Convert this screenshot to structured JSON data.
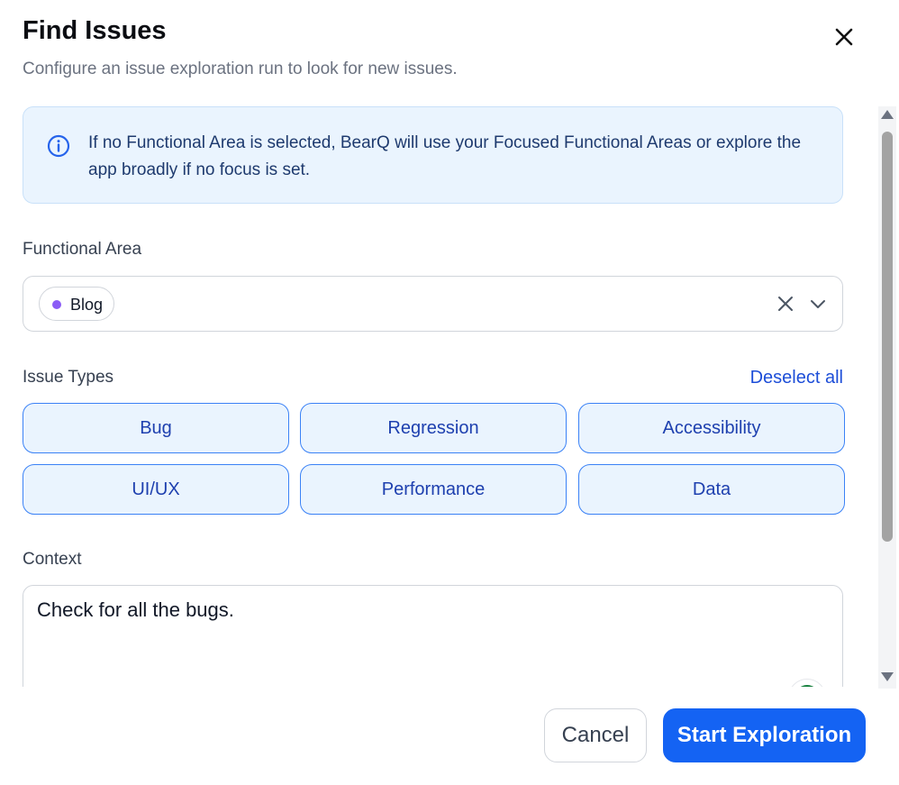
{
  "dialog": {
    "title": "Find Issues",
    "subtitle": "Configure an issue exploration run to look for new issues."
  },
  "info": {
    "message": "If no Functional Area is selected, BearQ will use your Focused Functional Areas or explore the app broadly if no focus is set."
  },
  "functional_area": {
    "label": "Functional Area",
    "selected": [
      {
        "label": "Blog",
        "dot_color": "#8b5cf6"
      }
    ]
  },
  "issue_types": {
    "label": "Issue Types",
    "deselect_label": "Deselect all",
    "items": [
      {
        "label": "Bug",
        "selected": true
      },
      {
        "label": "Regression",
        "selected": true
      },
      {
        "label": "Accessibility",
        "selected": true
      },
      {
        "label": "UI/UX",
        "selected": true
      },
      {
        "label": "Performance",
        "selected": true
      },
      {
        "label": "Data",
        "selected": true
      }
    ]
  },
  "context": {
    "label": "Context",
    "value": "Check for all the bugs."
  },
  "footer": {
    "cancel_label": "Cancel",
    "start_label": "Start Exploration"
  },
  "colors": {
    "primary": "#1463f3",
    "info_bg": "#eaf4fe",
    "chip_dot": "#8b5cf6"
  },
  "icons": [
    "close-icon",
    "info-icon",
    "clear-icon",
    "chevron-down-icon",
    "grammar-icon"
  ]
}
